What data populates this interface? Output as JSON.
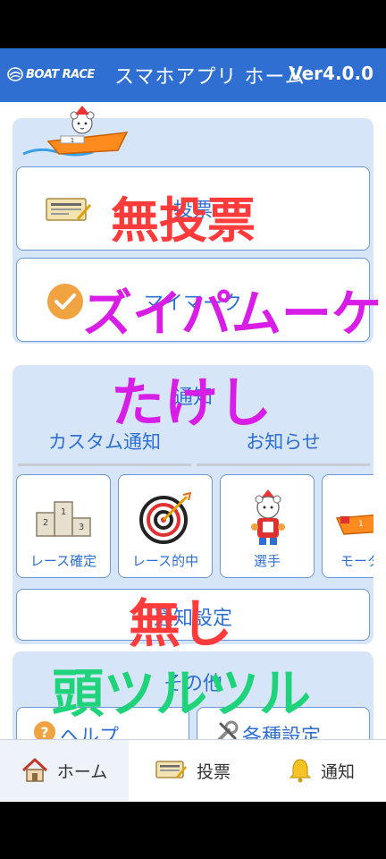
{
  "header": {
    "logo_text": "BOAT RACE",
    "title": "スマホアプリ ホーム",
    "version": "Ver4.0.0"
  },
  "main": {
    "vote_button_label": "投票",
    "mark_button_label": "マイマーク",
    "notify_section": {
      "title": "通知",
      "tabs": [
        "カスタム通知",
        "お知らせ"
      ],
      "tiles": [
        {
          "label": "レース確定",
          "icon": "podium-icon"
        },
        {
          "label": "レース的中",
          "icon": "target-icon"
        },
        {
          "label": "選手",
          "icon": "bear-racer-icon"
        },
        {
          "label": "モーター",
          "icon": "boat-icon"
        }
      ],
      "settings_label": "通知設定"
    },
    "other_section": {
      "title": "その他",
      "help_label": "ヘルプ",
      "settings_label": "各種設定"
    }
  },
  "overlays": {
    "text1": "無投票",
    "text2": "ズイパムーケ",
    "text3": "たけし",
    "text4": "無し",
    "text5": "頭ツルツル"
  },
  "tabbar": {
    "items": [
      {
        "label": "ホーム",
        "icon": "house-icon"
      },
      {
        "label": "投票",
        "icon": "ticket-icon"
      },
      {
        "label": "通知",
        "icon": "bell-icon"
      }
    ]
  },
  "colors": {
    "accent": "#2f6fd1",
    "panel": "#d6e6f8",
    "overlay_red": "#ff3b3b",
    "overlay_magenta": "#d81ee6",
    "overlay_green": "#1fd37a"
  }
}
